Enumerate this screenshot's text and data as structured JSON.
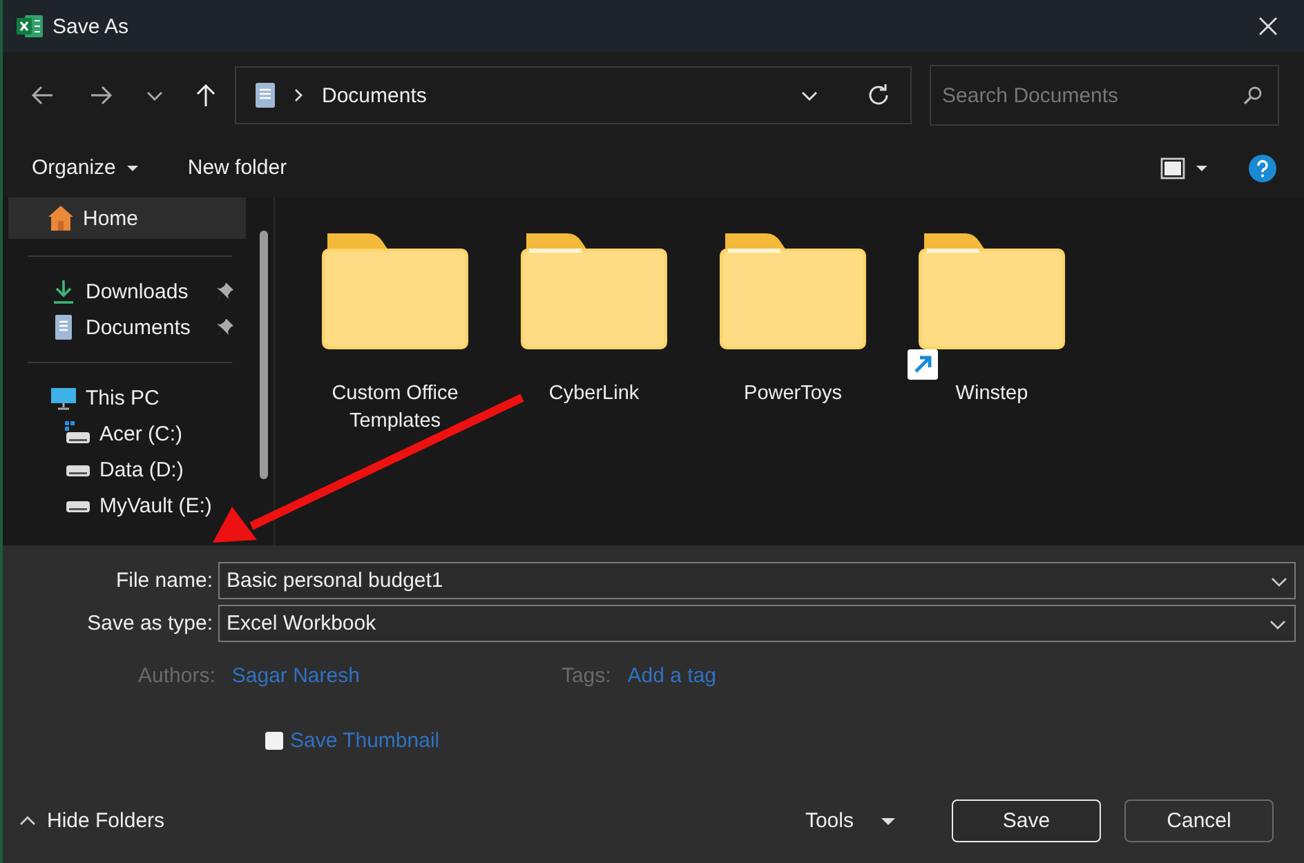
{
  "window": {
    "title": "Save As"
  },
  "nav": {
    "path": "Documents",
    "search": {
      "placeholder": "Search Documents"
    }
  },
  "toolbar": {
    "organize": "Organize",
    "new_folder": "New folder"
  },
  "sidebar": {
    "groups": [
      [
        {
          "label": "Home",
          "kind": "home",
          "selected": true,
          "pinned": false
        }
      ],
      [
        {
          "label": "Downloads",
          "kind": "downloads",
          "selected": false,
          "pinned": true
        },
        {
          "label": "Documents",
          "kind": "documents",
          "selected": false,
          "pinned": true
        }
      ],
      [
        {
          "label": "This PC",
          "kind": "pc",
          "selected": false,
          "pinned": false,
          "children": [
            {
              "label": "Acer (C:)",
              "kind": "system-drive",
              "selected": false,
              "pinned": false
            },
            {
              "label": "Data (D:)",
              "kind": "drive",
              "selected": false,
              "pinned": false
            },
            {
              "label": "MyVault (E:)",
              "kind": "drive",
              "selected": false,
              "pinned": false
            }
          ]
        }
      ]
    ]
  },
  "folders": [
    {
      "name": "Custom Office Templates",
      "shortcut": false
    },
    {
      "name": "CyberLink",
      "shortcut": false
    },
    {
      "name": "PowerToys",
      "shortcut": false
    },
    {
      "name": "Winstep",
      "shortcut": true
    }
  ],
  "form": {
    "file_name": {
      "label": "File name:",
      "value": "Basic personal budget1"
    },
    "save_type": {
      "label": "Save as type:",
      "value": "Excel Workbook"
    },
    "authors": {
      "label": "Authors:",
      "value": "Sagar Naresh"
    },
    "tags": {
      "label": "Tags:",
      "value": "Add a tag"
    },
    "thumbnail": {
      "label": "Save Thumbnail",
      "checked": false
    }
  },
  "footer": {
    "hide_folders": "Hide Folders",
    "tools": "Tools",
    "buttons": [
      {
        "label": "Save",
        "kind": "primary"
      },
      {
        "label": "Cancel",
        "kind": "secondary"
      }
    ]
  }
}
